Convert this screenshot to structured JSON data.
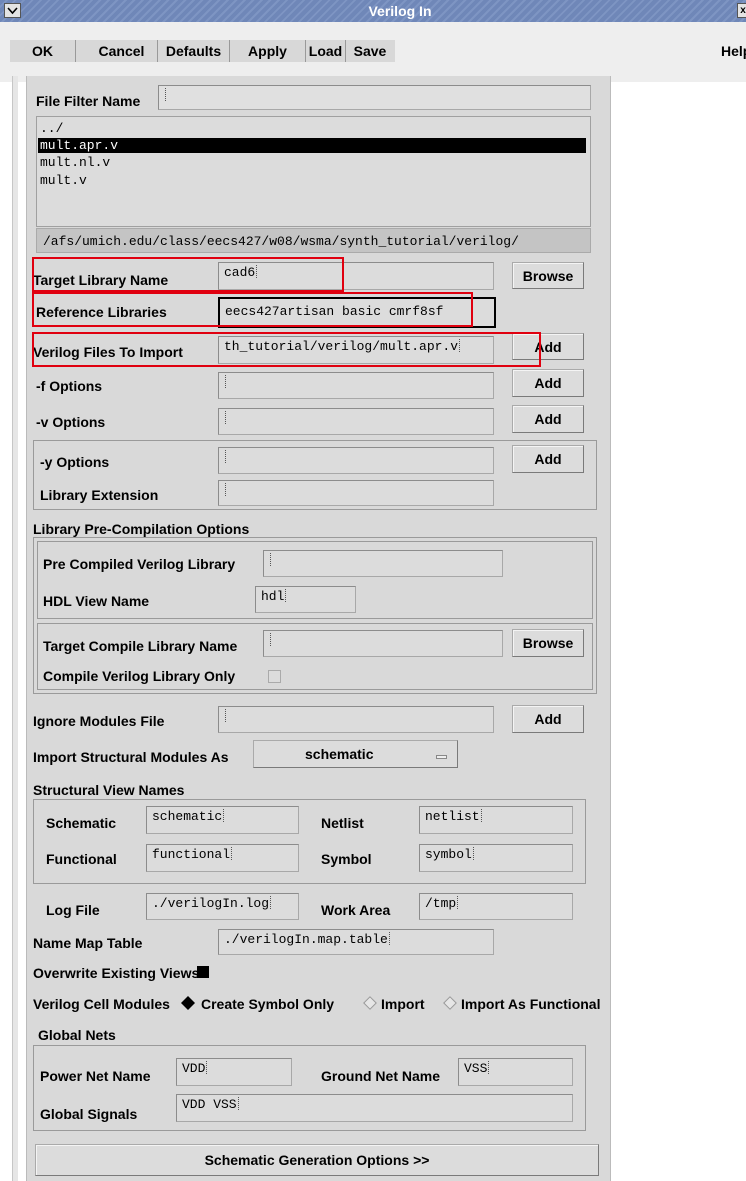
{
  "window": {
    "title": "Verilog In"
  },
  "toolbar": {
    "ok": "OK",
    "cancel": "Cancel",
    "defaults": "Defaults",
    "apply": "Apply",
    "load": "Load",
    "save": "Save",
    "help": "Help"
  },
  "file_filter": {
    "label": "File Filter Name",
    "value": ""
  },
  "file_list": {
    "items": [
      "../",
      "mult.apr.v",
      "mult.nl.v",
      "mult.v"
    ],
    "selected": "mult.apr.v",
    "path": "/afs/umich.edu/class/eecs427/w08/wsma/synth_tutorial/verilog/"
  },
  "target_library": {
    "label": "Target Library Name",
    "value": "cad6",
    "button": "Browse"
  },
  "reference_libraries": {
    "label": "Reference Libraries",
    "value": "eecs427artisan basic cmrf8sf"
  },
  "verilog_files": {
    "label": "Verilog Files To Import",
    "value": "th_tutorial/verilog/mult.apr.v",
    "button": "Add"
  },
  "f_options": {
    "label": "-f Options",
    "value": "",
    "button": "Add"
  },
  "v_options": {
    "label": "-v Options",
    "value": "",
    "button": "Add"
  },
  "y_options": {
    "label": "-y Options",
    "value": "",
    "button": "Add"
  },
  "library_extension": {
    "label": "Library Extension",
    "value": ""
  },
  "precompilation": {
    "title": "Library Pre-Compilation Options",
    "precompiled_label": "Pre Compiled Verilog Library",
    "precompiled_value": "",
    "hdl_label": "HDL View Name",
    "hdl_value": "hdl",
    "target_compile_label": "Target Compile Library Name",
    "target_compile_value": "",
    "browse": "Browse",
    "compile_only_label": "Compile Verilog Library Only"
  },
  "ignore_modules": {
    "label": "Ignore Modules File",
    "value": "",
    "button": "Add"
  },
  "import_structural": {
    "label": "Import Structural Modules As",
    "value": "schematic"
  },
  "structural_views": {
    "title": "Structural View Names",
    "schematic_label": "Schematic",
    "schematic_value": "schematic",
    "netlist_label": "Netlist",
    "netlist_value": "netlist",
    "functional_label": "Functional",
    "functional_value": "functional",
    "symbol_label": "Symbol",
    "symbol_value": "symbol"
  },
  "log_file": {
    "label": "Log File",
    "value": "./verilogIn.log"
  },
  "work_area": {
    "label": "Work Area",
    "value": "/tmp"
  },
  "name_map": {
    "label": "Name Map Table",
    "value": "./verilogIn.map.table"
  },
  "overwrite": {
    "label": "Overwrite Existing Views",
    "checked": true
  },
  "cell_modules": {
    "label": "Verilog Cell Modules",
    "options": [
      "Create Symbol Only",
      "Import",
      "Import As Functional"
    ],
    "selected": "Create Symbol Only"
  },
  "global_nets": {
    "title": "Global Nets",
    "power_label": "Power Net Name",
    "power_value": "VDD",
    "ground_label": "Ground Net Name",
    "ground_value": "VSS",
    "signals_label": "Global Signals",
    "signals_value": "VDD VSS"
  },
  "schematic_options": {
    "label": "Schematic Generation Options >>"
  },
  "colors": {
    "titlebar": "#6f87b8",
    "highlight": "#e0000f",
    "panel": "#d9d9d9"
  },
  "icons": [
    "window-menu-icon",
    "close-icon",
    "dropdown-icon"
  ]
}
